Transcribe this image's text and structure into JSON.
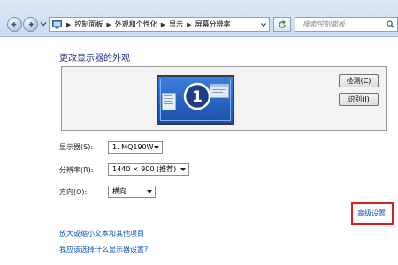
{
  "address_bar": {
    "crumbs": [
      "控制面板",
      "外观和个性化",
      "显示",
      "屏幕分辨率"
    ]
  },
  "search": {
    "placeholder": "搜索控制面板"
  },
  "main": {
    "title": "更改显示器的外观",
    "monitor_number": "1",
    "buttons": {
      "detect": "检测(C)",
      "identify": "识别(I)"
    },
    "fields": {
      "display": {
        "label": "显示器(S):",
        "value": "1. MQ190W"
      },
      "resolution": {
        "label": "分辨率(R):",
        "value": "1440 × 900 (推荐)"
      },
      "orientation": {
        "label": "方向(O):",
        "value": "横向"
      }
    },
    "advanced_link": "高级设置",
    "links": [
      "放大或缩小文本和其他项目",
      "我应该选择什么显示器设置?"
    ]
  },
  "colors": {
    "link": "#0b56b5",
    "title": "#1e3287",
    "highlight_box": "#d32222",
    "monitor": "#2f6ad0"
  },
  "icons": [
    "back-arrow-icon",
    "forward-arrow-icon",
    "control-panel-icon",
    "refresh-icon",
    "search-icon",
    "dropdown-arrow-icon"
  ]
}
